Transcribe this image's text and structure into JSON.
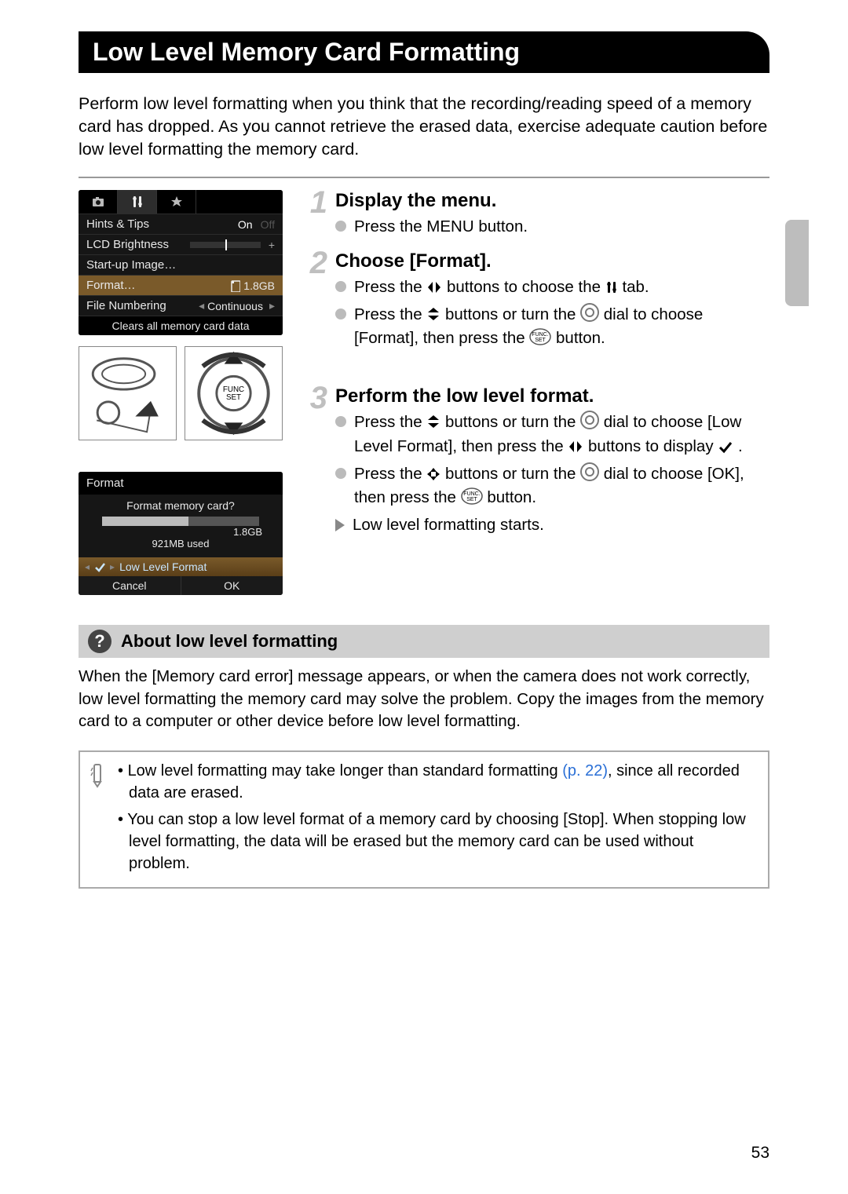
{
  "page": {
    "title": "Low Level Memory Card Formatting",
    "intro": "Perform low level formatting when you think that the recording/reading speed of a memory card has dropped. As you cannot retrieve the erased data, exercise adequate caution before low level formatting the memory card.",
    "number": "53"
  },
  "lcd1": {
    "rows": {
      "hints_label": "Hints & Tips",
      "hints_on": "On",
      "hints_off": "Off",
      "lcd_label": "LCD Brightness",
      "startup_label": "Start-up Image…",
      "format_label": "Format…",
      "format_size": "1.8GB",
      "filenum_label": "File Numbering",
      "filenum_value": "Continuous"
    },
    "footer": "Clears all memory card data"
  },
  "lcd2": {
    "title": "Format",
    "question": "Format memory card?",
    "size": "1.8GB",
    "used": "921MB used",
    "llf": "Low Level Format",
    "cancel": "Cancel",
    "ok": "OK"
  },
  "steps": {
    "s1": {
      "num": "1",
      "title": "Display the menu.",
      "b1a": "Press the ",
      "b1_menu": "MENU",
      "b1b": " button."
    },
    "s2": {
      "num": "2",
      "title": "Choose [Format].",
      "b1a": "Press the ",
      "b1b": " buttons to choose the ",
      "b1c": " tab.",
      "b2a": "Press the ",
      "b2b": " buttons or turn the ",
      "b2c": " dial to choose [Format], then press the ",
      "b2d": " button."
    },
    "s3": {
      "num": "3",
      "title": "Perform the low level format.",
      "b1a": "Press the ",
      "b1b": " buttons or turn the ",
      "b1c": " dial to choose [Low Level Format], then press the ",
      "b1d": " buttons to display ",
      "b1e": ".",
      "b2a": "Press the ",
      "b2b": " buttons or turn the ",
      "b2c": " dial to choose [OK], then press the ",
      "b2d": " button.",
      "b3": "Low level formatting starts."
    }
  },
  "about": {
    "title": "About low level formatting",
    "body": "When the [Memory card error] message appears, or when the camera does not work correctly, low level formatting the memory card may solve the problem. Copy the images from the memory card to a computer or other device before low level formatting."
  },
  "note": {
    "n1a": "Low level formatting may take longer than standard formatting ",
    "n1_ref": "(p. 22)",
    "n1b": ", since all recorded data are erased.",
    "n2": "You can stop a low level format of a memory card by choosing [Stop]. When stopping low level formatting, the data will be erased but the memory card can be used without problem."
  }
}
